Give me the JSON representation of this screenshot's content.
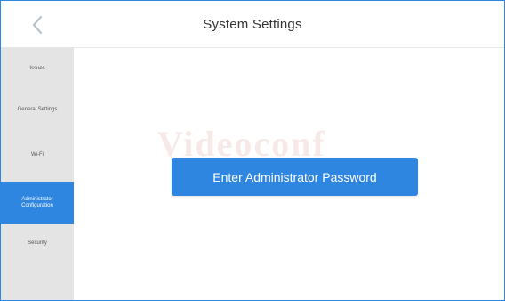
{
  "header": {
    "title": "System Settings",
    "back_icon": "chevron-left-icon"
  },
  "sidebar": {
    "items": [
      {
        "label": "Issues"
      },
      {
        "label": "General Settings"
      },
      {
        "label": "Wi-Fi"
      },
      {
        "label": "Administrator Configuration",
        "active": true
      },
      {
        "label": "Security"
      }
    ]
  },
  "main": {
    "watermark": "Videoconf",
    "enter_button_label": "Enter Administrator Password"
  },
  "colors": {
    "accent": "#2f86e0",
    "sidebar_bg": "#e4e4e4",
    "title_text": "#333333",
    "back_icon": "#b9c2cc"
  }
}
